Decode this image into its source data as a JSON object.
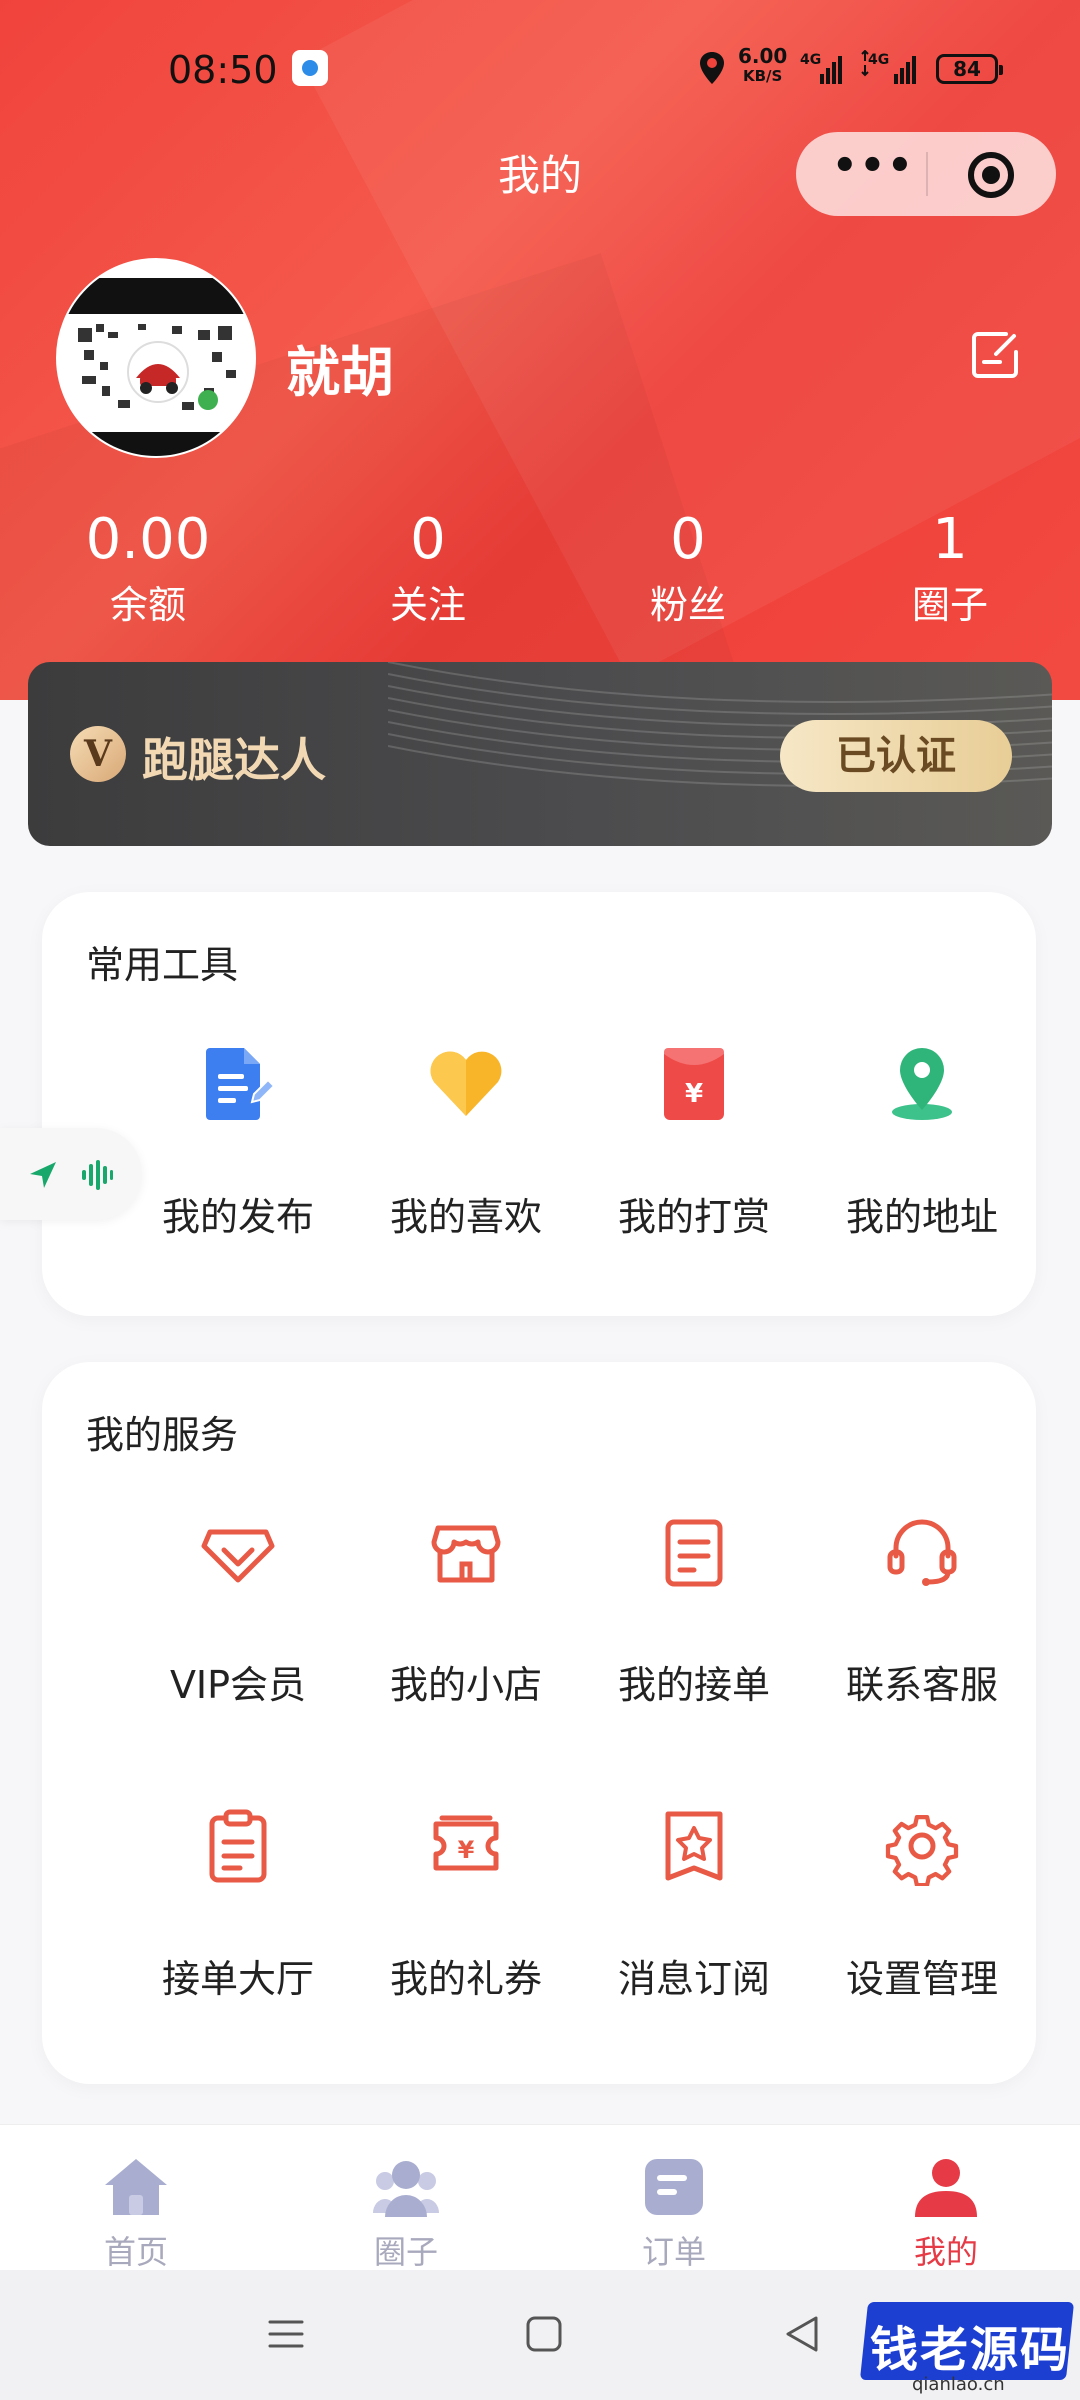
{
  "status_bar": {
    "time": "08:50",
    "speed_value": "6.00",
    "speed_unit": "KB/S",
    "signal_1": "4G",
    "signal_2": "4G",
    "battery": "84"
  },
  "header": {
    "title": "我的",
    "username": "就胡"
  },
  "stats": [
    {
      "value": "0.00",
      "label": "余额"
    },
    {
      "value": "0",
      "label": "关注"
    },
    {
      "value": "0",
      "label": "粉丝"
    },
    {
      "value": "1",
      "label": "圈子"
    }
  ],
  "vip_card": {
    "badge": "V",
    "title": "跑腿达人",
    "status": "已认证"
  },
  "common_tools": {
    "title": "常用工具",
    "items": [
      {
        "label": "我的发布",
        "icon": "document-edit-icon"
      },
      {
        "label": "我的喜欢",
        "icon": "heart-icon"
      },
      {
        "label": "我的打赏",
        "icon": "red-envelope-icon"
      },
      {
        "label": "我的地址",
        "icon": "location-pin-icon"
      }
    ]
  },
  "my_services": {
    "title": "我的服务",
    "items": [
      {
        "label": "VIP会员",
        "icon": "diamond-icon"
      },
      {
        "label": "我的小店",
        "icon": "shop-icon"
      },
      {
        "label": "我的接单",
        "icon": "order-note-icon"
      },
      {
        "label": "联系客服",
        "icon": "headset-icon"
      },
      {
        "label": "接单大厅",
        "icon": "clipboard-icon"
      },
      {
        "label": "我的礼券",
        "icon": "coupon-icon"
      },
      {
        "label": "消息订阅",
        "icon": "bookmark-star-icon"
      },
      {
        "label": "设置管理",
        "icon": "gear-icon"
      }
    ]
  },
  "tabbar": [
    {
      "label": "首页",
      "icon": "home-icon"
    },
    {
      "label": "圈子",
      "icon": "circle-group-icon"
    },
    {
      "label": "订单",
      "icon": "order-icon"
    },
    {
      "label": "我的",
      "icon": "user-icon"
    }
  ],
  "watermark": {
    "brand": "钱老源码",
    "url": "qianlao.cn"
  },
  "colors": {
    "header_red": "#f0433c",
    "accent": "#e85a45",
    "tab_active": "#e63b46",
    "tab_inactive": "#a9a9bd",
    "vip_gold": "#f2d9b4"
  }
}
